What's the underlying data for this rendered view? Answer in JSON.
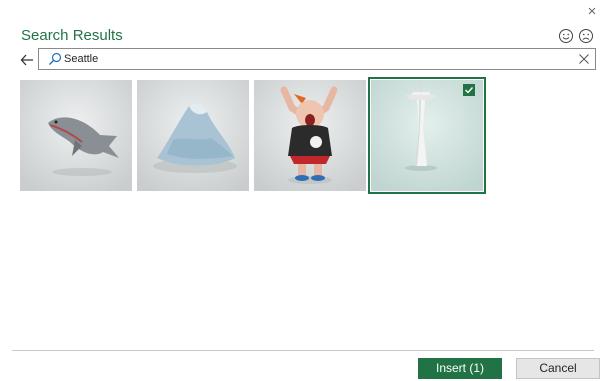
{
  "dialog": {
    "title": "Search Results",
    "icons": {
      "close": "close-icon",
      "smile": "smile-icon",
      "frown": "frown-icon",
      "back": "back-arrow-icon"
    }
  },
  "search": {
    "value": "Seattle",
    "icon": "search-icon",
    "clear_icon": "clear-icon"
  },
  "results": [
    {
      "subject": "salmon",
      "selected": false
    },
    {
      "subject": "mount-rainier",
      "selected": false
    },
    {
      "subject": "cartoon-figure",
      "selected": false
    },
    {
      "subject": "space-needle",
      "selected": true
    }
  ],
  "footer": {
    "insert_label": "Insert (1)",
    "cancel_label": "Cancel"
  },
  "colors": {
    "accent": "#217346",
    "tile_bg": "#d8dcdc",
    "selected_tile_bg": "#cfe1dc"
  }
}
